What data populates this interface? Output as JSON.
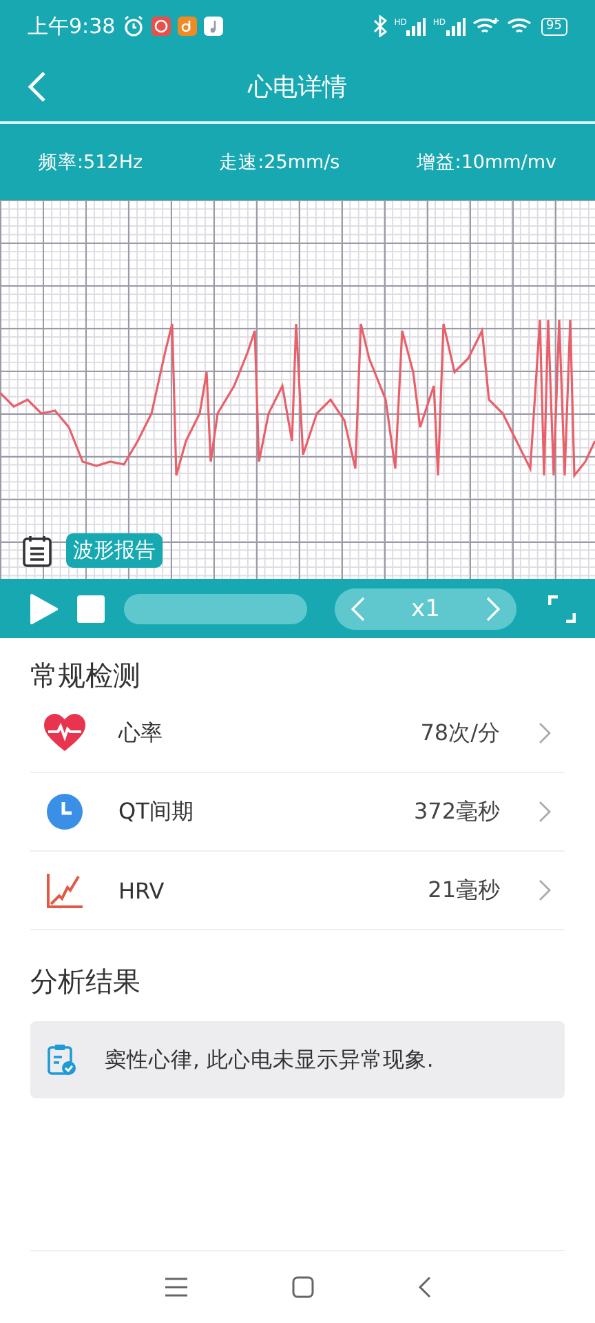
{
  "status_bar": {
    "time": "上午9:38",
    "signal_labels": [
      "HD",
      "HD"
    ],
    "battery": "95"
  },
  "nav": {
    "title": "心电详情"
  },
  "ecg_info": [
    "频率:512Hz",
    "走速:25mm/s",
    "增益:10mm/mv"
  ],
  "ecg": {
    "report_button": "波形报告"
  },
  "playback": {
    "level": 0,
    "speed": "x1"
  },
  "routine": {
    "title": "常规检测",
    "items": [
      {
        "kind": "heart",
        "label": "心率",
        "value": "78次/分"
      },
      {
        "kind": "clock",
        "label": "QT间期",
        "value": "372毫秒"
      },
      {
        "kind": "chart",
        "label": "HRV",
        "value": "21毫秒"
      }
    ]
  },
  "analysis": {
    "title": "分析结果",
    "result": "窦性心律, 此心电未显示异常现象."
  }
}
